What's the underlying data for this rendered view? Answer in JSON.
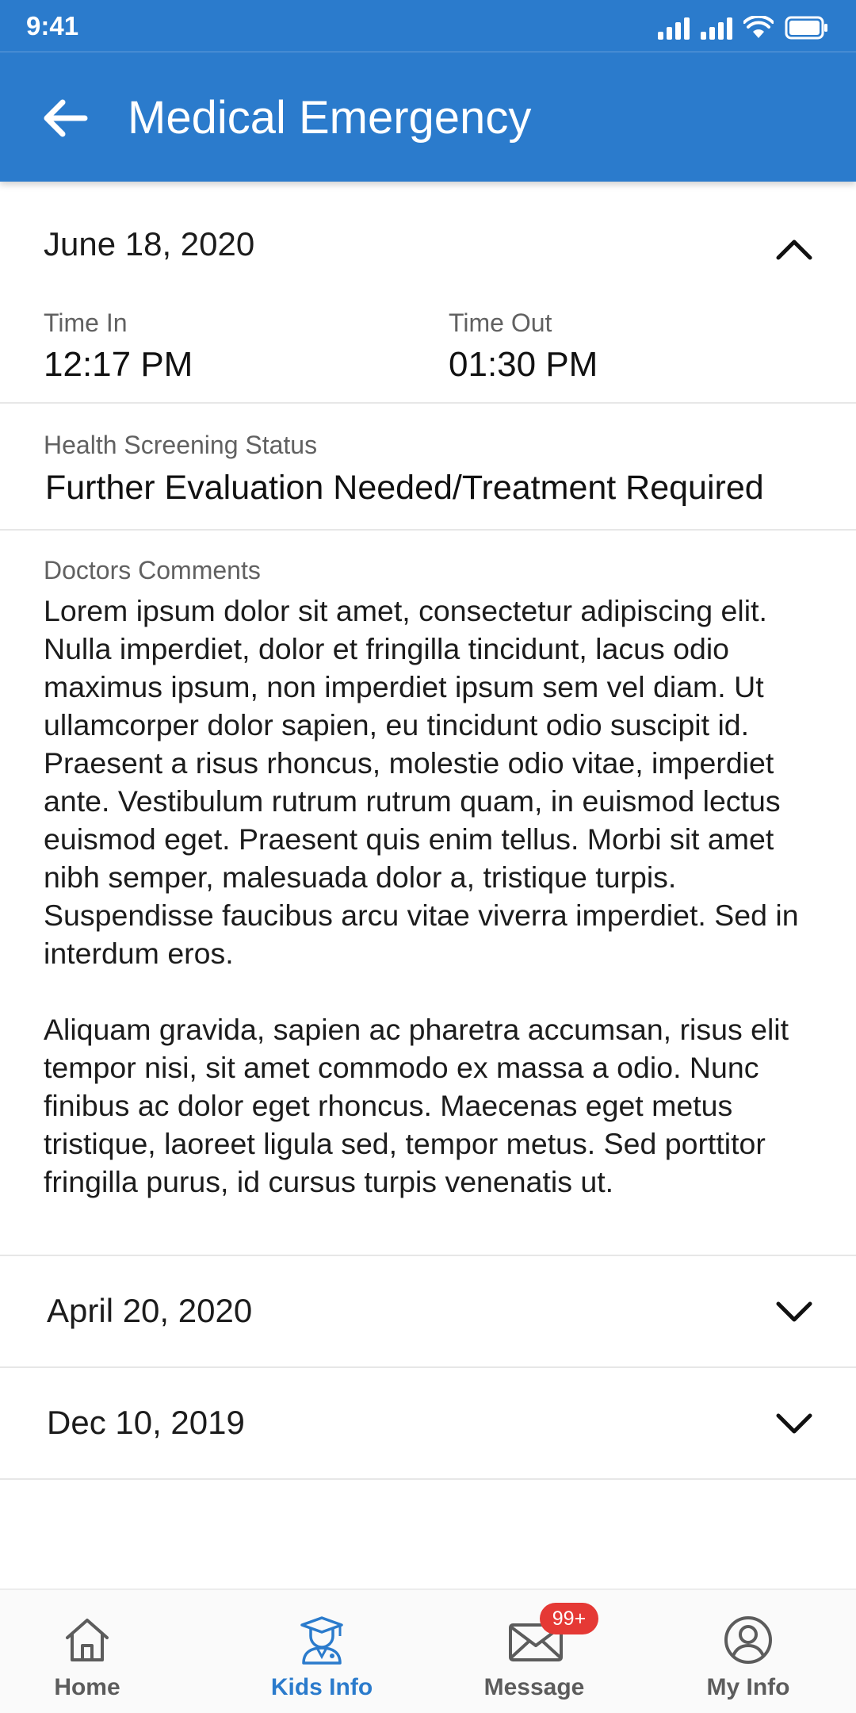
{
  "status_bar": {
    "time": "9:41"
  },
  "header": {
    "title": "Medical Emergency"
  },
  "records": {
    "expanded": {
      "date": "June 18, 2020",
      "time_in_label": "Time In",
      "time_in": "12:17 PM",
      "time_out_label": "Time Out",
      "time_out": "01:30 PM",
      "health_label": "Health Screening Status",
      "health_value": "Further Evaluation Needed/Treatment Required",
      "comments_label": "Doctors Comments",
      "comments_p1": "Lorem ipsum dolor sit amet, consectetur adipiscing elit. Nulla imperdiet, dolor et fringilla tincidunt, lacus odio maximus ipsum, non imperdiet ipsum sem vel diam. Ut ullamcorper dolor sapien, eu tincidunt odio suscipit id. Praesent a risus rhoncus, molestie odio vitae, imperdiet ante. Vestibulum rutrum rutrum quam, in euismod lectus euismod eget. Praesent quis enim tellus. Morbi sit amet nibh semper, malesuada dolor a, tristique turpis. Suspendisse faucibus arcu vitae viverra imperdiet. Sed in interdum eros.",
      "comments_p2": "Aliquam gravida, sapien ac pharetra accumsan, risus elit tempor nisi, sit amet commodo ex massa a odio. Nunc finibus ac dolor eget rhoncus. Maecenas eget metus tristique, laoreet ligula sed, tempor metus. Sed porttitor fringilla purus, id cursus turpis venenatis ut."
    },
    "collapsed": [
      {
        "date": "April 20, 2020"
      },
      {
        "date": "Dec 10, 2019"
      }
    ]
  },
  "bottom_nav": {
    "items": [
      {
        "label": "Home",
        "icon": "home-icon"
      },
      {
        "label": "Kids Info",
        "icon": "graduate-icon",
        "active": true
      },
      {
        "label": "Message",
        "icon": "mail-icon",
        "badge": "99+"
      },
      {
        "label": "My Info",
        "icon": "user-icon"
      }
    ]
  },
  "colors": {
    "primary": "#2b7bcc",
    "badge": "#e53935",
    "text": "#1c1c1c",
    "label": "#616161",
    "inactive_nav": "#5c5c5c"
  }
}
